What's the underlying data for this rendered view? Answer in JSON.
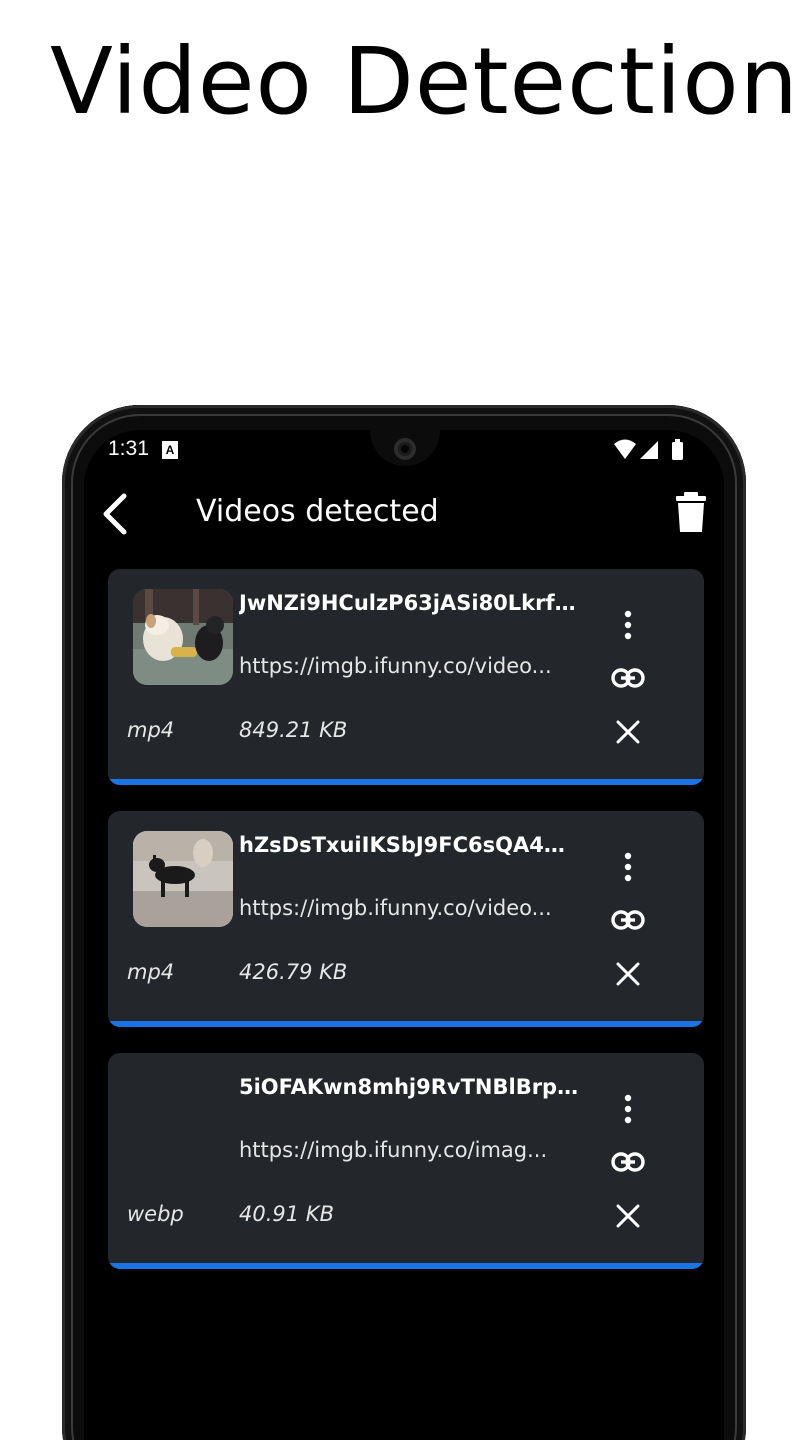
{
  "headline": "Video Detection",
  "status_bar": {
    "time": "1:31",
    "a_icon": "A"
  },
  "toolbar": {
    "title": "Videos detected",
    "back_icon": "chevron-left-icon",
    "delete_icon": "trash-icon"
  },
  "colors": {
    "card_background": "#23262a",
    "accent_bar": "#1a74e6",
    "screen_background": "#000000"
  },
  "videos": [
    {
      "name": "JwNZi9HCulzP63jASi80LkrfFa...",
      "url": "https://imgb.ifunny.co/video...",
      "format": "mp4",
      "size": "849.21 KB",
      "thumbnail": "dog-and-cat-photo"
    },
    {
      "name": "hZsDsTxuiIKSbJ9FC6sQA4H67...",
      "url": "https://imgb.ifunny.co/video...",
      "format": "mp4",
      "size": "426.79 KB",
      "thumbnail": "small-dog-on-pavement-photo"
    },
    {
      "name": "5iOFAKwn8mhj9RvTNBlBrpVJ...",
      "url": "https://imgb.ifunny.co/imag...",
      "format": "webp",
      "size": "40.91 KB",
      "thumbnail": ""
    }
  ]
}
